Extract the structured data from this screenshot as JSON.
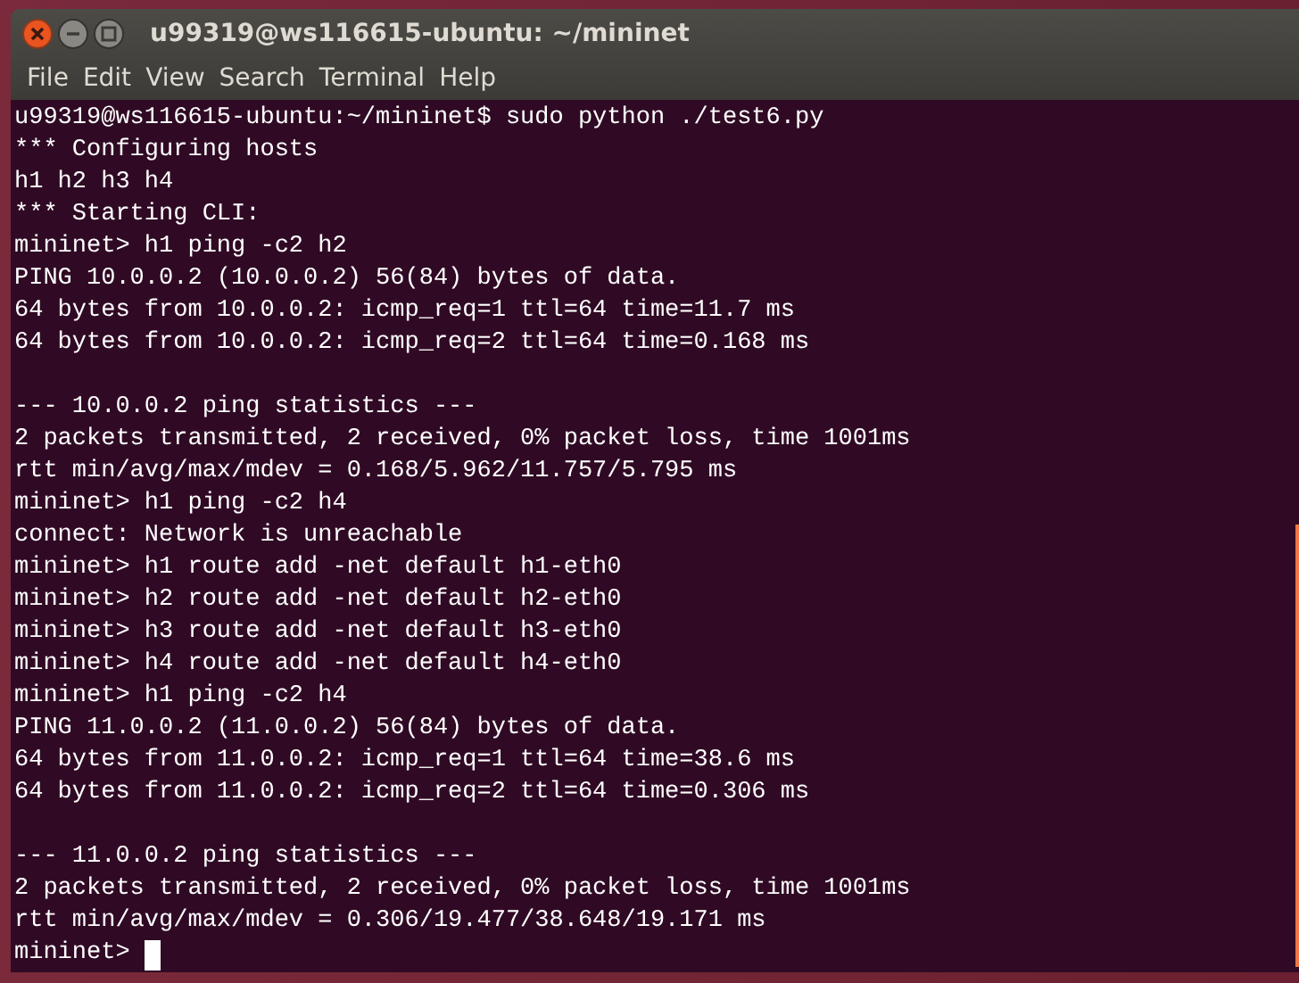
{
  "window": {
    "title": "u99319@ws116615-ubuntu: ~/mininet"
  },
  "menu": [
    "File",
    "Edit",
    "View",
    "Search",
    "Terminal",
    "Help"
  ],
  "terminal": {
    "blocks": [
      [
        "u99319@ws116615-ubuntu:~/mininet$ sudo python ./test6.py",
        "*** Configuring hosts",
        "h1 h2 h3 h4",
        "*** Starting CLI:",
        "mininet> h1 ping -c2 h2",
        "PING 10.0.0.2 (10.0.0.2) 56(84) bytes of data.",
        "64 bytes from 10.0.0.2: icmp_req=1 ttl=64 time=11.7 ms",
        "64 bytes from 10.0.0.2: icmp_req=2 ttl=64 time=0.168 ms"
      ],
      [
        "--- 10.0.0.2 ping statistics ---",
        "2 packets transmitted, 2 received, 0% packet loss, time 1001ms",
        "rtt min/avg/max/mdev = 0.168/5.962/11.757/5.795 ms",
        "mininet> h1 ping -c2 h4",
        "connect: Network is unreachable",
        "mininet> h1 route add -net default h1-eth0",
        "mininet> h2 route add -net default h2-eth0",
        "mininet> h3 route add -net default h3-eth0",
        "mininet> h4 route add -net default h4-eth0",
        "mininet> h1 ping -c2 h4",
        "PING 11.0.0.2 (11.0.0.2) 56(84) bytes of data.",
        "64 bytes from 11.0.0.2: icmp_req=1 ttl=64 time=38.6 ms",
        "64 bytes from 11.0.0.2: icmp_req=2 ttl=64 time=0.306 ms"
      ],
      [
        "--- 11.0.0.2 ping statistics ---",
        "2 packets transmitted, 2 received, 0% packet loss, time 1001ms",
        "rtt min/avg/max/mdev = 0.306/19.477/38.648/19.171 ms"
      ]
    ],
    "prompt": "mininet>"
  }
}
